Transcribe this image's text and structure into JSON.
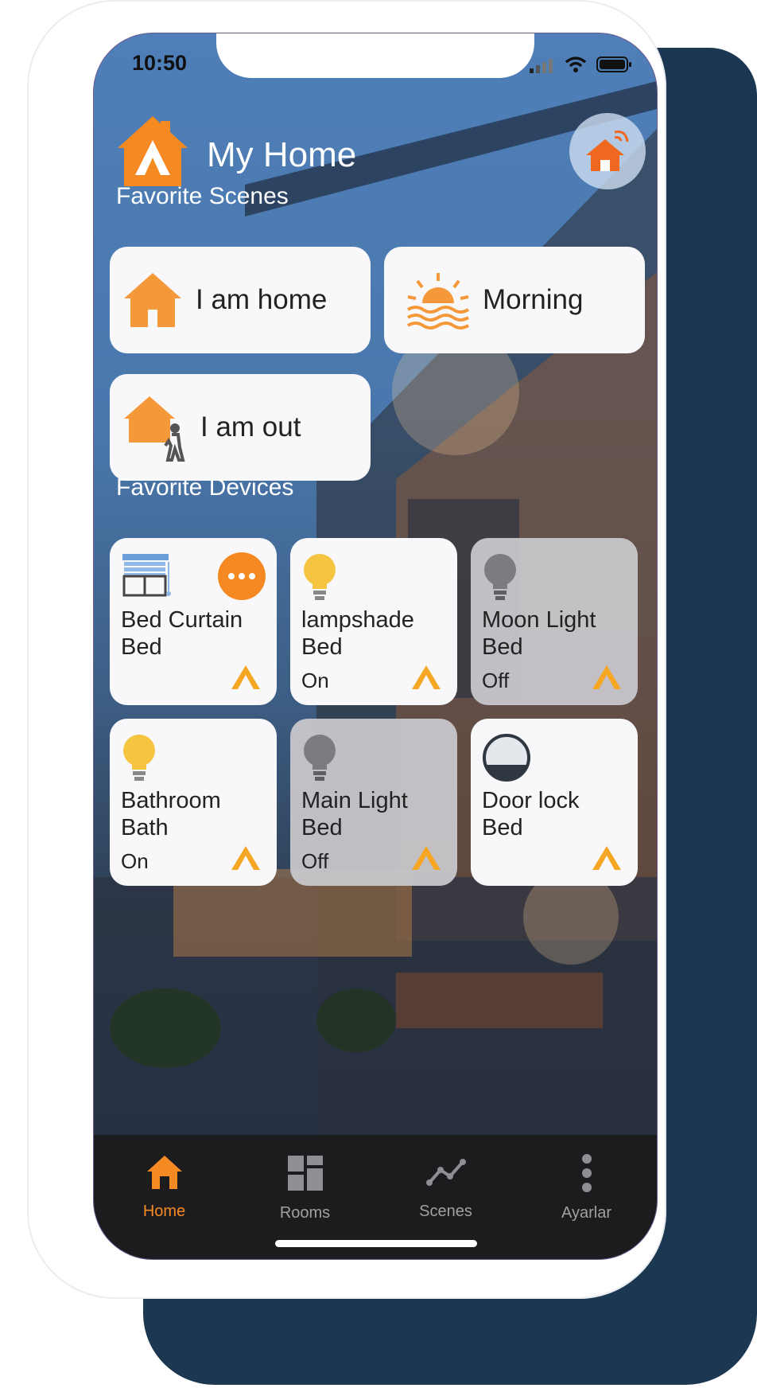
{
  "status_bar": {
    "time": "10:50"
  },
  "header": {
    "title": "My Home"
  },
  "sections": {
    "scenes": "Favorite Scenes",
    "devices": "Favorite Devices"
  },
  "scenes": [
    {
      "label": "I am home",
      "icon": "house-icon"
    },
    {
      "label": "Morning",
      "icon": "sunrise-icon"
    },
    {
      "label": "I am out",
      "icon": "house-person-icon"
    }
  ],
  "devices": [
    {
      "name": "Bed Curtain",
      "room": "Bed",
      "state": "",
      "icon": "curtain-icon",
      "on": true
    },
    {
      "name": "lampshade",
      "room": "Bed",
      "state": "On",
      "icon": "bulb-icon",
      "on": true
    },
    {
      "name": "Moon Light",
      "room": "Bed",
      "state": "Off",
      "icon": "bulb-icon",
      "on": false
    },
    {
      "name": "Bathroom",
      "room": "Bath",
      "state": "On",
      "icon": "bulb-icon",
      "on": true
    },
    {
      "name": "Main Light",
      "room": "Bed",
      "state": "Off",
      "icon": "bulb-icon",
      "on": false
    },
    {
      "name": "Door lock",
      "room": "Bed",
      "state": "",
      "icon": "lock-icon",
      "on": true
    }
  ],
  "tabs": [
    {
      "label": "Home",
      "active": true
    },
    {
      "label": "Rooms",
      "active": false
    },
    {
      "label": "Scenes",
      "active": false
    },
    {
      "label": "Ayarlar",
      "active": false
    }
  ],
  "colors": {
    "accent": "#f58a23",
    "tile": "#f8f8fa",
    "tile_off": "#c8c8cc",
    "tabbar": "#1c1c1e"
  }
}
